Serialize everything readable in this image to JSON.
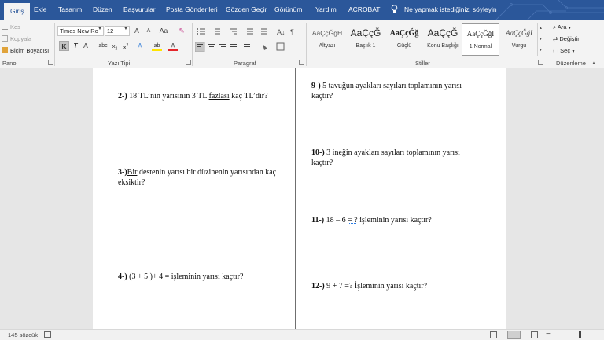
{
  "tabs": [
    {
      "label": "Giriş",
      "active": true
    },
    {
      "label": "Ekle"
    },
    {
      "label": "Tasarım"
    },
    {
      "label": "Düzen"
    },
    {
      "label": "Başvurular"
    },
    {
      "label": "Posta Gönderileri"
    },
    {
      "label": "Gözden Geçir"
    },
    {
      "label": "Görünüm"
    },
    {
      "label": "Yardım"
    },
    {
      "label": "ACROBAT"
    }
  ],
  "tell_me": "Ne yapmak istediğinizi söyleyin",
  "clipboard": {
    "cut": "Kes",
    "copy": "Kopyala",
    "format_painter": "Biçim Boyacısı",
    "group_label": "Pano"
  },
  "font": {
    "name": "Times New Ro",
    "size": "12",
    "grow": "A",
    "shrink": "A",
    "case": "Aa",
    "bold": "K",
    "italic": "T",
    "underline": "A",
    "strike": "abc",
    "subscript": "x",
    "superscript": "x",
    "effects": "A",
    "highlight": "ab",
    "color": "A",
    "group_label": "Yazı Tipi"
  },
  "paragraph": {
    "group_label": "Paragraf"
  },
  "styles": {
    "group_label": "Stiller",
    "items": [
      {
        "preview": "AaÇçĞğH",
        "name": "Altyazı"
      },
      {
        "preview": "AaÇçĞ",
        "name": "Başlık 1"
      },
      {
        "preview": "AaÇçĞğ",
        "name": "Güçlü"
      },
      {
        "preview": "AaÇçĞ",
        "name": "Konu Başlığı"
      },
      {
        "preview": "AaÇçĞğI",
        "name": "1 Normal",
        "selected": true
      },
      {
        "preview": "AaÇçĞğI",
        "name": "Vurgu"
      }
    ]
  },
  "editing": {
    "find": "Ara",
    "replace": "Değiştir",
    "select": "Seç",
    "group_label": "Düzenleme"
  },
  "questions_left": [
    {
      "num": "2-)",
      "parts": [
        {
          "t": " 18 TL’nin yarısının 3 TL "
        },
        {
          "t": "fazlası",
          "u": true
        },
        {
          "t": " kaç TL’dir?"
        }
      ]
    },
    {
      "num": "3-)",
      "parts": [
        {
          "t": "Bir",
          "u": true
        },
        {
          "t": " destenin yarısı bir düzinenin yarısından kaç eksiktir?"
        }
      ]
    },
    {
      "num": "4-)",
      "parts": [
        {
          "t": " (3 + "
        },
        {
          "t": "5",
          "u": true
        },
        {
          "t": " )+ 4 = işleminin "
        },
        {
          "t": "yarısı",
          "u": true
        },
        {
          "t": " kaçtır?"
        }
      ]
    }
  ],
  "questions_right": [
    {
      "num": "9-)",
      "parts": [
        {
          "t": " 5 tavuğun ayakları sayıları toplamının yarısı kaçtır?"
        }
      ]
    },
    {
      "num": "10-)",
      "parts": [
        {
          "t": " 3 ineğin ayakları sayıları toplamının yarısı kaçtır?"
        }
      ]
    },
    {
      "num": "11-)",
      "parts": [
        {
          "t": " 18 – 6 "
        },
        {
          "t": "= ?",
          "d": true
        },
        {
          "t": " işleminin yarısı kaçtır?"
        }
      ]
    },
    {
      "num": "12-)",
      "parts": [
        {
          "t": " 9 + 7 =? İşleminin yarısı kaçtır?"
        }
      ]
    }
  ],
  "status": {
    "word_count": "145 sözcük"
  }
}
